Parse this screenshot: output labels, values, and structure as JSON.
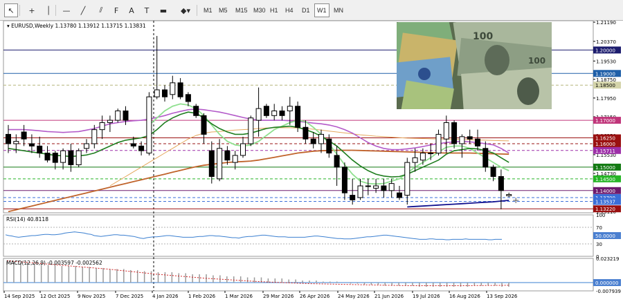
{
  "toolbar": {
    "tools": [
      {
        "icon": "cursor-icon",
        "glyph": "↖"
      },
      {
        "icon": "crosshair-icon",
        "glyph": "+"
      },
      {
        "icon": "vertical-line-icon",
        "glyph": "│"
      },
      {
        "icon": "horizontal-line-icon",
        "glyph": "—"
      },
      {
        "icon": "trendline-icon",
        "glyph": "╱"
      },
      {
        "icon": "equidistant-channel-icon",
        "glyph": "⫽"
      },
      {
        "icon": "fibonacci-icon",
        "glyph": "F"
      },
      {
        "icon": "text-icon",
        "glyph": "A"
      },
      {
        "icon": "text-label-icon",
        "glyph": "T"
      },
      {
        "icon": "rectangle-icon",
        "glyph": "▬"
      },
      {
        "icon": "shapes-icon",
        "glyph": "◆▾"
      }
    ],
    "timeframes": [
      "M1",
      "M5",
      "M15",
      "M30",
      "H1",
      "H4",
      "D1",
      "W1",
      "MN"
    ],
    "active_timeframe": "W1"
  },
  "header": {
    "symbol_line": "EURUSD,Weekly  1.13780 1.13912 1.13715 1.13831"
  },
  "price_axis": {
    "ticks": [
      "1.21190",
      "1.20370",
      "1.19530",
      "1.18750",
      "1.17950",
      "1.17150",
      "1.16350",
      "1.15530",
      "1.14730",
      "1.13950",
      "1.13110"
    ],
    "tags": [
      {
        "label": "1.20000",
        "price": 1.2,
        "bg": "#1c1c6e",
        "fg": "#ffffff"
      },
      {
        "label": "1.19000",
        "price": 1.19,
        "bg": "#1f5fa8",
        "fg": "#ffffff"
      },
      {
        "label": "1.18500",
        "price": 1.185,
        "bg": "#d4d4aa",
        "fg": "#000000"
      },
      {
        "label": "1.17000",
        "price": 1.17,
        "bg": "#c0357a",
        "fg": "#ffffff"
      },
      {
        "label": "1.16250",
        "price": 1.1625,
        "bg": "#9a1010",
        "fg": "#ffffff"
      },
      {
        "label": "1.16000",
        "price": 1.16,
        "bg": "#9a1010",
        "fg": "#ffffff"
      },
      {
        "label": "1.15711",
        "price": 1.15711,
        "bg": "#9d2fa8",
        "fg": "#ffffff"
      },
      {
        "label": "1.15000",
        "price": 1.15,
        "bg": "#137a13",
        "fg": "#ffffff"
      },
      {
        "label": "1.14500",
        "price": 1.145,
        "bg": "#26b526",
        "fg": "#ffffff"
      },
      {
        "label": "1.14000",
        "price": 1.14,
        "bg": "#6e1a6e",
        "fg": "#ffffff"
      },
      {
        "label": "1.13700",
        "price": 1.137,
        "bg": "#3a6ed8",
        "fg": "#ffffff"
      },
      {
        "label": "1.13537",
        "price": 1.13537,
        "bg": "#3a6ed8",
        "fg": "#ffffff"
      },
      {
        "label": "1.13220",
        "price": 1.1322,
        "bg": "#9a1010",
        "fg": "#ffffff"
      }
    ]
  },
  "date_axis": [
    "14 Sep 2025",
    "12 Oct 2025",
    "9 Nov 2025",
    "7 Dec 2025",
    "4 Jan 2026",
    "1 Feb 2026",
    "1 Mar 2026",
    "29 Mar 2026",
    "26 Apr 2026",
    "24 May 2026",
    "21 Jun 2026",
    "19 Jul 2026",
    "16 Aug 2026",
    "13 Sep 2026"
  ],
  "rsi": {
    "label": "RSI(14) 40.8118",
    "ticks": [
      "100",
      "70",
      "50",
      "30",
      "0"
    ],
    "tag": "50.0000",
    "values": [
      52,
      50,
      49,
      47,
      46,
      47,
      48,
      49,
      50,
      50,
      51,
      52,
      53,
      53,
      52,
      52,
      53,
      54,
      56,
      57,
      58,
      59,
      58,
      57,
      56,
      54,
      53,
      50,
      49,
      48,
      49,
      50,
      51,
      52,
      52,
      51,
      51,
      50,
      49,
      48,
      46,
      44,
      43,
      45,
      46,
      47,
      47,
      48,
      49,
      50,
      50,
      49,
      48,
      47,
      46,
      46,
      46,
      46,
      47,
      48,
      48,
      49,
      50,
      50,
      49,
      49,
      48,
      47,
      46,
      45,
      45,
      44,
      46,
      47,
      48,
      48,
      49,
      50,
      51,
      51,
      50,
      49,
      48,
      47,
      47,
      47,
      46,
      46,
      46,
      46,
      46,
      46,
      47,
      48,
      49,
      49,
      48,
      47,
      46,
      45,
      44,
      43,
      43,
      42,
      42,
      42,
      43,
      44,
      45,
      46,
      47,
      47,
      48,
      49,
      50,
      51,
      51,
      50,
      49,
      48,
      47,
      46,
      45,
      44,
      43,
      42,
      41,
      41,
      41,
      42,
      42,
      41,
      41,
      41,
      40,
      40,
      41,
      41,
      41,
      41,
      42,
      41,
      41,
      41,
      41,
      41,
      41,
      40,
      40,
      41,
      41,
      41
    ]
  },
  "macd": {
    "label": "MACD(12,26,9) -0.003597 -0.002562",
    "ticks": [
      "0.023219",
      "0.000000",
      "-0.007939"
    ],
    "tag": "0.000000",
    "bars": [
      0.02,
      0.02,
      0.019,
      0.019,
      0.018,
      0.018,
      0.017,
      0.017,
      0.016,
      0.016,
      0.016,
      0.015,
      0.015,
      0.014,
      0.014,
      0.013,
      0.013,
      0.013,
      0.012,
      0.012,
      0.011,
      0.011,
      0.01,
      0.01,
      0.01,
      0.009,
      0.009,
      0.008,
      0.008,
      0.008,
      0.007,
      0.007,
      0.006,
      0.006,
      0.006,
      0.005,
      0.005,
      0.005,
      0.004,
      0.004,
      0.004,
      0.003,
      0.003,
      0.002,
      0.002,
      0.002,
      0.001,
      0.001,
      0.001,
      0.0,
      -0.001,
      -0.001,
      -0.002,
      -0.002,
      -0.002,
      -0.003,
      -0.003,
      -0.003,
      -0.003,
      -0.003,
      -0.004,
      -0.004,
      -0.004,
      -0.004,
      -0.004,
      -0.004,
      -0.004,
      -0.004,
      -0.003,
      -0.003,
      -0.003,
      -0.003,
      -0.004,
      -0.004
    ],
    "signal": [
      0.021,
      0.017,
      0.013,
      0.008,
      0.004,
      0.001,
      -0.001,
      -0.002,
      -0.003,
      -0.003,
      -0.0026
    ]
  },
  "chart_data": {
    "type": "candlestick",
    "symbol": "EURUSD",
    "timeframe": "Weekly",
    "ylim": [
      1.1305,
      1.2125
    ],
    "candles": [
      [
        1.164,
        1.168,
        1.156,
        1.16
      ],
      [
        1.16,
        1.164,
        1.156,
        1.161
      ],
      [
        1.165,
        1.168,
        1.159,
        1.162
      ],
      [
        1.16,
        1.164,
        1.156,
        1.159
      ],
      [
        1.159,
        1.163,
        1.154,
        1.156
      ],
      [
        1.156,
        1.159,
        1.152,
        1.153
      ],
      [
        1.156,
        1.157,
        1.149,
        1.152
      ],
      [
        1.152,
        1.158,
        1.149,
        1.157
      ],
      [
        1.157,
        1.16,
        1.148,
        1.151
      ],
      [
        1.151,
        1.158,
        1.15,
        1.157
      ],
      [
        1.158,
        1.162,
        1.156,
        1.16
      ],
      [
        1.16,
        1.168,
        1.158,
        1.166
      ],
      [
        1.166,
        1.172,
        1.162,
        1.169
      ],
      [
        1.169,
        1.172,
        1.165,
        1.17
      ],
      [
        1.17,
        1.175,
        1.169,
        1.174
      ],
      [
        1.174,
        1.176,
        1.168,
        1.17
      ],
      [
        1.16,
        1.163,
        1.158,
        1.159
      ],
      [
        1.159,
        1.161,
        1.155,
        1.157
      ],
      [
        1.156,
        1.182,
        1.155,
        1.18
      ],
      [
        1.18,
        1.206,
        1.179,
        1.183
      ],
      [
        1.183,
        1.185,
        1.178,
        1.18
      ],
      [
        1.181,
        1.189,
        1.179,
        1.186
      ],
      [
        1.186,
        1.188,
        1.179,
        1.18
      ],
      [
        1.181,
        1.182,
        1.176,
        1.178
      ],
      [
        1.176,
        1.177,
        1.171,
        1.172
      ],
      [
        1.172,
        1.173,
        1.16,
        1.164
      ],
      [
        1.157,
        1.161,
        1.143,
        1.146
      ],
      [
        1.145,
        1.162,
        1.144,
        1.158
      ],
      [
        1.157,
        1.159,
        1.151,
        1.153
      ],
      [
        1.152,
        1.157,
        1.149,
        1.155
      ],
      [
        1.155,
        1.163,
        1.154,
        1.16
      ],
      [
        1.16,
        1.172,
        1.159,
        1.171
      ],
      [
        1.17,
        1.184,
        1.163,
        1.175
      ],
      [
        1.176,
        1.177,
        1.171,
        1.172
      ],
      [
        1.172,
        1.177,
        1.17,
        1.174
      ],
      [
        1.174,
        1.176,
        1.17,
        1.172
      ],
      [
        1.174,
        1.18,
        1.168,
        1.176
      ],
      [
        1.176,
        1.178,
        1.165,
        1.167
      ],
      [
        1.167,
        1.17,
        1.16,
        1.162
      ],
      [
        1.162,
        1.165,
        1.158,
        1.16
      ],
      [
        1.16,
        1.166,
        1.156,
        1.164
      ],
      [
        1.162,
        1.164,
        1.154,
        1.156
      ],
      [
        1.155,
        1.159,
        1.142,
        1.15
      ],
      [
        1.15,
        1.152,
        1.136,
        1.139
      ],
      [
        1.138,
        1.145,
        1.134,
        1.136
      ],
      [
        1.137,
        1.145,
        1.136,
        1.142
      ],
      [
        1.142,
        1.145,
        1.138,
        1.142
      ],
      [
        1.141,
        1.145,
        1.139,
        1.142
      ],
      [
        1.142,
        1.145,
        1.137,
        1.14
      ],
      [
        1.14,
        1.145,
        1.137,
        1.143
      ],
      [
        1.139,
        1.142,
        1.136,
        1.137
      ],
      [
        1.138,
        1.154,
        1.134,
        1.152
      ],
      [
        1.152,
        1.158,
        1.148,
        1.154
      ],
      [
        1.153,
        1.158,
        1.151,
        1.156
      ],
      [
        1.156,
        1.16,
        1.153,
        1.156
      ],
      [
        1.156,
        1.166,
        1.155,
        1.164
      ],
      [
        1.162,
        1.172,
        1.156,
        1.169
      ],
      [
        1.169,
        1.17,
        1.158,
        1.16
      ],
      [
        1.16,
        1.164,
        1.154,
        1.163
      ],
      [
        1.163,
        1.166,
        1.16,
        1.162
      ],
      [
        1.162,
        1.166,
        1.157,
        1.159
      ],
      [
        1.158,
        1.161,
        1.148,
        1.15
      ],
      [
        1.15,
        1.151,
        1.144,
        1.146
      ],
      [
        1.146,
        1.149,
        1.132,
        1.14
      ],
      [
        1.1378,
        1.1391,
        1.1372,
        1.1383
      ]
    ],
    "ma_green": [
      1.158,
      1.1575,
      1.157,
      1.1565,
      1.156,
      1.1555,
      1.155,
      1.1548,
      1.1545,
      1.1548,
      1.1552,
      1.156,
      1.1575,
      1.159,
      1.1605,
      1.1615,
      1.162,
      1.1625,
      1.1635,
      1.166,
      1.169,
      1.171,
      1.1725,
      1.1735,
      1.173,
      1.171,
      1.1685,
      1.1665,
      1.165,
      1.164,
      1.164,
      1.1645,
      1.1655,
      1.1665,
      1.167,
      1.1672,
      1.1675,
      1.167,
      1.166,
      1.1648,
      1.1632,
      1.1612,
      1.159,
      1.156,
      1.153,
      1.1505,
      1.1485,
      1.147,
      1.1462,
      1.1458,
      1.146,
      1.147,
      1.1485,
      1.15,
      1.1515,
      1.153,
      1.1555,
      1.157,
      1.1575,
      1.158,
      1.1578,
      1.157,
      1.156,
      1.154,
      1.152
    ],
    "ma_lightgreen": [
      null,
      null,
      null,
      null,
      null,
      null,
      null,
      null,
      null,
      null,
      null,
      null,
      null,
      null,
      null,
      null,
      null,
      null,
      1.168,
      1.171,
      1.174,
      1.176,
      1.177,
      1.1765,
      1.175,
      1.172,
      1.168,
      1.164,
      1.161,
      1.1595,
      1.159,
      1.1595,
      1.161,
      1.1635,
      1.166,
      1.1675,
      1.169,
      1.17,
      1.1695,
      1.167,
      1.164,
      1.16,
      1.1555,
      1.151,
      1.147,
      1.144,
      1.143,
      1.1428,
      1.143,
      1.144,
      1.145,
      1.1475,
      1.15,
      1.152,
      1.154,
      1.1565,
      1.1585,
      1.159,
      1.159,
      1.158,
      1.156,
      1.154,
      1.152,
      1.15,
      1.1485
    ],
    "ma_violet": [
      1.166,
      1.166,
      1.166,
      1.1658,
      1.1655,
      1.1652,
      1.165,
      1.1648,
      1.165,
      1.1652,
      1.1658,
      1.1665,
      1.1675,
      1.1685,
      1.169,
      1.1695,
      1.1698,
      1.17,
      1.1705,
      1.1712,
      1.172,
      1.173,
      1.1738,
      1.1745,
      1.1748,
      1.1745,
      1.174,
      1.1735,
      1.1728,
      1.172,
      1.1712,
      1.1705,
      1.17,
      1.17,
      1.17,
      1.17,
      1.1698,
      1.1695,
      1.1692,
      1.1688,
      1.1685,
      1.168,
      1.1672,
      1.166,
      1.1645,
      1.1625,
      1.1605,
      1.159,
      1.158,
      1.1575,
      1.1575,
      1.1578,
      1.1582,
      1.1588,
      1.1595,
      1.16,
      1.1605,
      1.1608,
      1.161,
      1.1608,
      1.1605,
      1.16,
      1.1595,
      1.158,
      1.156
    ],
    "ma_orange": [
      null,
      null,
      null,
      null,
      null,
      null,
      null,
      null,
      null,
      null,
      null,
      null,
      null,
      1.142,
      1.144,
      1.146,
      1.148,
      1.15,
      1.152,
      1.154,
      1.156,
      1.158,
      1.16,
      1.162,
      1.1635,
      1.1645,
      1.165,
      1.1652,
      1.1655,
      1.1658,
      1.166,
      1.1662,
      1.1665,
      1.1667,
      1.1668,
      1.1668,
      1.1668,
      1.1667,
      1.1665,
      1.1662,
      1.1658,
      1.1654,
      1.165,
      1.1646,
      1.1642,
      1.1638,
      1.1635,
      1.1632,
      1.163,
      1.1628,
      1.1626,
      1.1624,
      1.1623,
      1.1622,
      1.1621,
      1.162,
      1.162,
      1.1619,
      1.1618,
      1.1617,
      1.1616,
      1.1615,
      1.1614,
      1.1613,
      1.1612
    ],
    "ma_brown": [
      1.131,
      1.1318,
      1.1326,
      1.1334,
      1.1342,
      1.135,
      1.1358,
      1.1366,
      1.1374,
      1.1382,
      1.139,
      1.1398,
      1.1406,
      1.1414,
      1.1422,
      1.143,
      1.1438,
      1.1446,
      1.1454,
      1.1462,
      1.147,
      1.1478,
      1.1486,
      1.1494,
      1.1502,
      1.1508,
      1.1512,
      1.1516,
      1.152,
      1.1522,
      1.1524,
      1.1526,
      1.153,
      1.1536,
      1.1542,
      1.1548,
      1.1554,
      1.156,
      1.1564,
      1.1568,
      1.157,
      1.1571,
      1.1572,
      1.1572,
      1.1572,
      1.1571,
      1.157,
      1.1569,
      1.1568,
      1.1567,
      1.1566,
      1.1565,
      1.1564,
      1.1563,
      1.1562,
      1.1561,
      1.156,
      1.156,
      1.156,
      1.156,
      1.1559,
      1.1558,
      1.1557,
      1.1556,
      1.1555
    ],
    "ma_navy": [
      null,
      null,
      null,
      null,
      null,
      null,
      null,
      null,
      null,
      null,
      null,
      null,
      null,
      null,
      null,
      null,
      null,
      null,
      null,
      null,
      null,
      null,
      null,
      null,
      null,
      null,
      null,
      null,
      null,
      null,
      null,
      null,
      null,
      null,
      null,
      null,
      null,
      null,
      null,
      null,
      null,
      null,
      null,
      null,
      null,
      null,
      null,
      null,
      null,
      null,
      null,
      1.133,
      1.1332,
      1.1334,
      1.1336,
      1.1338,
      1.134,
      1.1342,
      1.1344,
      1.1346,
      1.1348,
      1.135,
      1.1352,
      1.1355,
      1.1358
    ],
    "hlines": [
      {
        "price": 1.2,
        "color": "#1c1c6e",
        "dash": false
      },
      {
        "price": 1.19,
        "color": "#1f5fa8",
        "dash": false
      },
      {
        "price": 1.185,
        "color": "#b5b57a",
        "dash": true
      },
      {
        "price": 1.17,
        "color": "#c0357a",
        "dash": false
      },
      {
        "price": 1.1625,
        "color": "#9a1010",
        "dash": false
      },
      {
        "price": 1.16,
        "color": "#9a1010",
        "dash": true
      },
      {
        "price": 1.15711,
        "color": "#9d2fa8",
        "dash": true
      },
      {
        "price": 1.15,
        "color": "#137a13",
        "dash": false
      },
      {
        "price": 1.145,
        "color": "#26b526",
        "dash": true
      },
      {
        "price": 1.14,
        "color": "#6e1a6e",
        "dash": false
      },
      {
        "price": 1.137,
        "color": "#3a6ed8",
        "dash": true
      },
      {
        "price": 1.13537,
        "color": "#3a6ed8",
        "dash": true
      },
      {
        "price": 1.1322,
        "color": "#9a1010",
        "dash": false
      }
    ]
  }
}
